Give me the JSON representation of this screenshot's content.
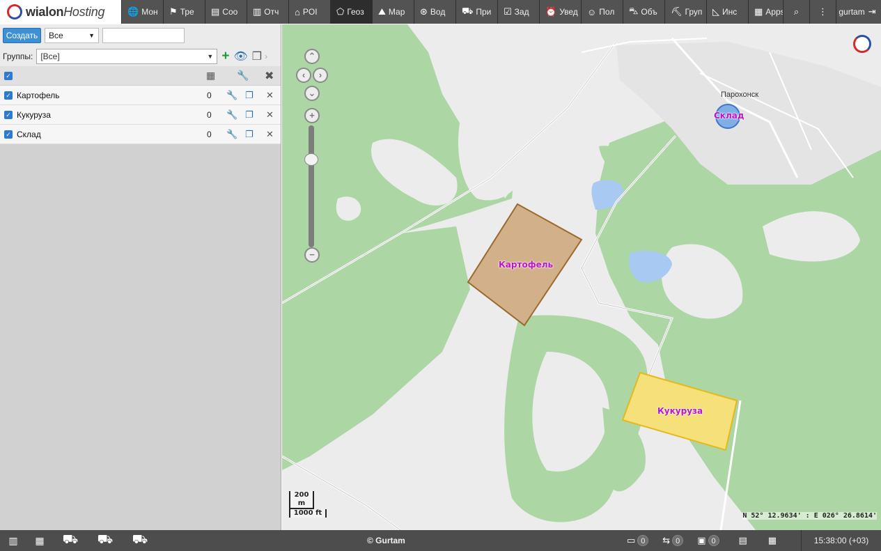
{
  "topbar": {
    "brand_main": "wialon",
    "brand_sub": "Hosting",
    "nav": [
      {
        "label": "Мон",
        "icon": "globe-icon",
        "glyph": "🌐"
      },
      {
        "label": "Тре",
        "icon": "flag-icon",
        "glyph": "⚑"
      },
      {
        "label": "Соо",
        "icon": "messages-icon",
        "glyph": "▤"
      },
      {
        "label": "Отч",
        "icon": "reports-icon",
        "glyph": "▥"
      },
      {
        "label": "POI",
        "icon": "poi-icon",
        "glyph": "⌂"
      },
      {
        "label": "Геоз",
        "icon": "geofence-icon",
        "glyph": "⬠"
      },
      {
        "label": "Мар",
        "icon": "routes-icon",
        "glyph": "⛰"
      },
      {
        "label": "Вод",
        "icon": "drivers-icon",
        "glyph": "⊛"
      },
      {
        "label": "При",
        "icon": "trailers-icon",
        "glyph": "⛟"
      },
      {
        "label": "Зад",
        "icon": "jobs-icon",
        "glyph": "☑"
      },
      {
        "label": "Увед",
        "icon": "notifications-icon",
        "glyph": "⏰"
      },
      {
        "label": "Пол",
        "icon": "users-icon",
        "glyph": "☺"
      },
      {
        "label": "Объ",
        "icon": "units-icon",
        "glyph": "⛍"
      },
      {
        "label": "Груп",
        "icon": "unit-groups-icon",
        "glyph": "⛏"
      },
      {
        "label": "Инс",
        "icon": "tools-icon",
        "glyph": "◺"
      }
    ],
    "apps_label": "Apps",
    "user_label": "gurtam",
    "icons": {
      "apps": "apps-grid-icon",
      "search": "search-icon",
      "more": "more-vertical-icon",
      "logout": "logout-icon"
    }
  },
  "leftpanel": {
    "create_label": "Создать",
    "type_select_value": "Все",
    "search_placeholder": "",
    "groups_label": "Группы:",
    "groups_select_value": "[Все]",
    "items": [
      {
        "name": "Картофель",
        "count": "0"
      },
      {
        "name": "Кукуруза",
        "count": "0"
      },
      {
        "name": "Склад",
        "count": "0"
      }
    ]
  },
  "map": {
    "town_label": "Парохонск",
    "geofences": [
      {
        "label": "Склад",
        "fill": "#6fa6e8"
      },
      {
        "label": "Картофель",
        "fill": "#d2b08a"
      },
      {
        "label": "Кукуруза",
        "fill": "#f5e07a"
      }
    ],
    "scale_m": "200 m",
    "scale_ft": "1000 ft",
    "coordinates": "N 52° 12.9634' : E 026° 26.8614'"
  },
  "bottombar": {
    "copyright": "© Gurtam",
    "badges": [
      "0",
      "0",
      "0"
    ],
    "clock": "15:38:00 (+03)"
  },
  "colors": {
    "topbar": "#4d4d4d",
    "accent": "#3d8fd6",
    "forest": "#a9d4a1",
    "water": "#a8caf2"
  }
}
